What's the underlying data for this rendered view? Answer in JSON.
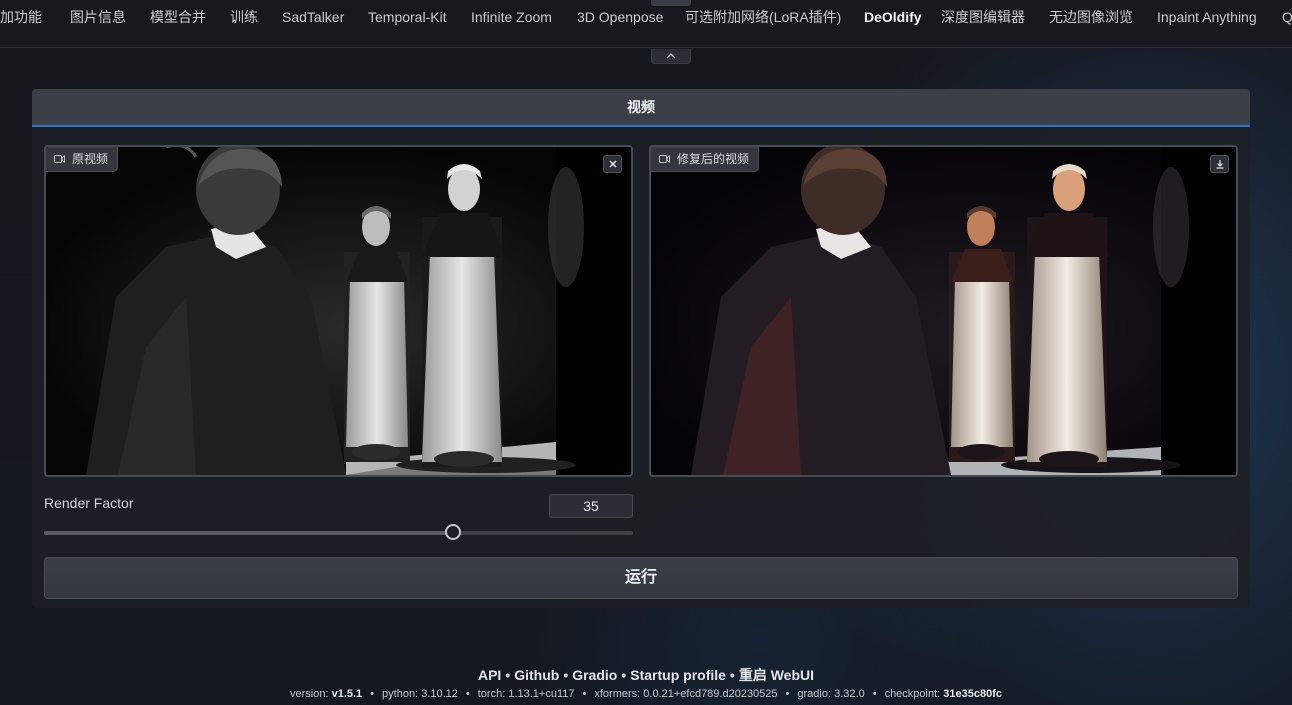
{
  "top_tabs": [
    {
      "label": "附加功能",
      "display": "加功能",
      "active": false
    },
    {
      "label": "图片信息",
      "active": false
    },
    {
      "label": "模型合并",
      "active": false
    },
    {
      "label": "训练",
      "active": false
    },
    {
      "label": "SadTalker",
      "active": false
    },
    {
      "label": "Temporal-Kit",
      "active": false
    },
    {
      "label": "Infinite Zoom",
      "active": false
    },
    {
      "label": "3D Openpose",
      "active": false
    },
    {
      "label": "可选附加网络(LoRA插件)",
      "active": false
    },
    {
      "label": "DeOldify",
      "active": true
    },
    {
      "label": "深度图编辑器",
      "active": false
    },
    {
      "label": "无边图像浏览",
      "active": false
    },
    {
      "label": "Inpaint Anything",
      "active": false
    },
    {
      "label": "Q",
      "active": false
    }
  ],
  "section": {
    "title": "视频"
  },
  "input_video": {
    "label": "原视频",
    "clear_icon": "close-icon",
    "camera_icon": "video-camera-icon"
  },
  "output_video": {
    "label": "修复后的视频",
    "download_icon": "download-icon",
    "camera_icon": "video-camera-icon"
  },
  "render_factor": {
    "label": "Render Factor",
    "value": 35,
    "min": 1,
    "max": 50
  },
  "run_button": {
    "label": "运行"
  },
  "footer": {
    "links": [
      "API",
      "Github",
      "Gradio",
      "Startup profile",
      "重启 WebUI"
    ],
    "versions": [
      {
        "key": "version:",
        "value": "v1.5.1",
        "bold": true
      },
      {
        "key": "python:",
        "value": "3.10.12",
        "bold": false
      },
      {
        "key": "torch:",
        "value": "1.13.1+cu117",
        "bold": false
      },
      {
        "key": "xformers:",
        "value": "0.0.21+efcd789.d20230525",
        "bold": false
      },
      {
        "key": "gradio:",
        "value": "3.32.0",
        "bold": false
      },
      {
        "key": "checkpoint:",
        "value": "31e35c80fc",
        "bold": true
      }
    ]
  },
  "colors": {
    "accent": "#2f73d1",
    "panel": "#1c1f25",
    "header": "#3b3f47"
  }
}
